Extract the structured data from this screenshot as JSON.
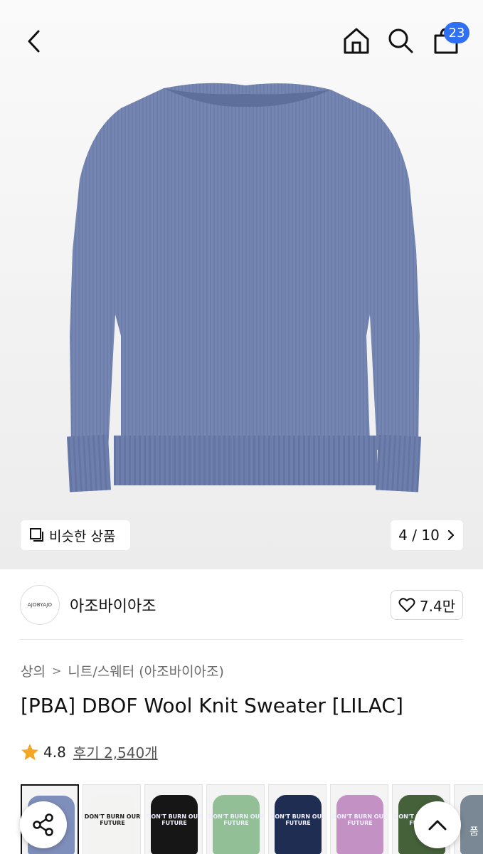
{
  "header": {
    "cart_count": "23"
  },
  "hero": {
    "similar_label": "비슷한 상품",
    "image_counter": "4 / 10"
  },
  "brand": {
    "logo_text": "AJOBYAJO",
    "name": "아조바이아조",
    "likes": "7.4만"
  },
  "breadcrumb": [
    "상의",
    "니트/스웨터 (아조바이아조)"
  ],
  "product": {
    "title": "[PBA] DBOF Wool Knit Sweater [LILAC]",
    "rating": "4.8",
    "reviews": "후기 2,540개"
  },
  "thumbnails": [
    {
      "color": "#7f8fbb",
      "text": ""
    },
    {
      "color": "#f3f3f1",
      "text": "DON'T BURN OUR FUTURE"
    },
    {
      "color": "#161616",
      "text": "DON'T BURN OUR FUTURE"
    },
    {
      "color": "#93bf96",
      "text": "DON'T BURN OUR FUTURE"
    },
    {
      "color": "#1f2d52",
      "text": "DON'T BURN OUR FUTURE"
    },
    {
      "color": "#c391c4",
      "text": "DON'T BURN OUR FUTURE"
    },
    {
      "color": "#45613a",
      "text": "DON'T BURN OUR FUTURE"
    },
    {
      "color": "#7a8795",
      "text": ""
    }
  ],
  "side_label": "품",
  "colors": {
    "accent": "#2f6ff2",
    "star": "#f5a623",
    "sweater": "#7283b0"
  }
}
